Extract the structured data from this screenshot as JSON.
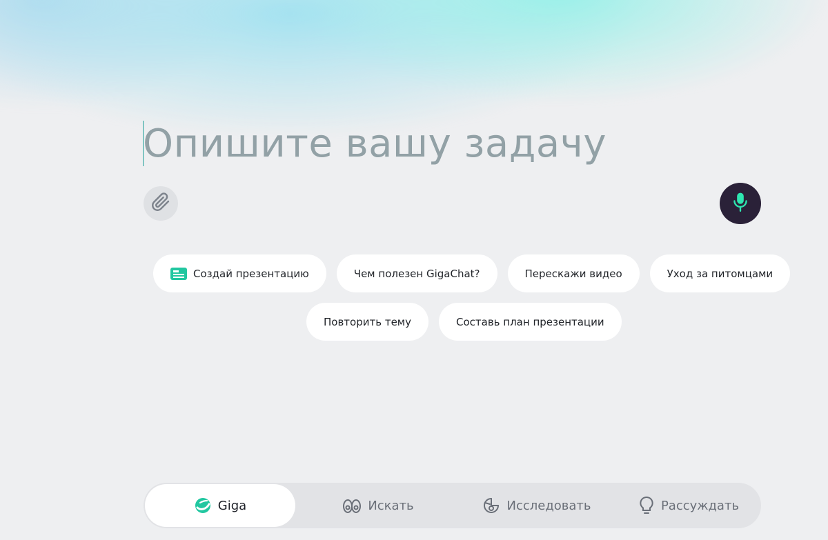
{
  "prompt": {
    "placeholder": "Опишите вашу задачу"
  },
  "icons": {
    "attach": "paperclip-icon",
    "mic": "microphone-icon",
    "presentation": "presentation-icon",
    "giga": "giga-logo-icon",
    "search": "binoculars-icon",
    "explore": "explore-icon",
    "reason": "lightbulb-icon"
  },
  "colors": {
    "accent": "#21c7a0",
    "mic_bg": "#2a2138",
    "chip_bg": "#ffffff",
    "mode_bar_bg": "#e2e3e6"
  },
  "suggestions": {
    "row1": [
      "Создай презентацию",
      "Чем полезен GigaChat?",
      "Перескажи видео",
      "Уход за питомцами"
    ],
    "row2": [
      "Повторить тему",
      "Составь план презентации"
    ]
  },
  "modes": [
    {
      "label": "Giga",
      "active": true
    },
    {
      "label": "Искать",
      "active": false
    },
    {
      "label": "Исследовать",
      "active": false
    },
    {
      "label": "Рассуждать",
      "active": false
    }
  ]
}
